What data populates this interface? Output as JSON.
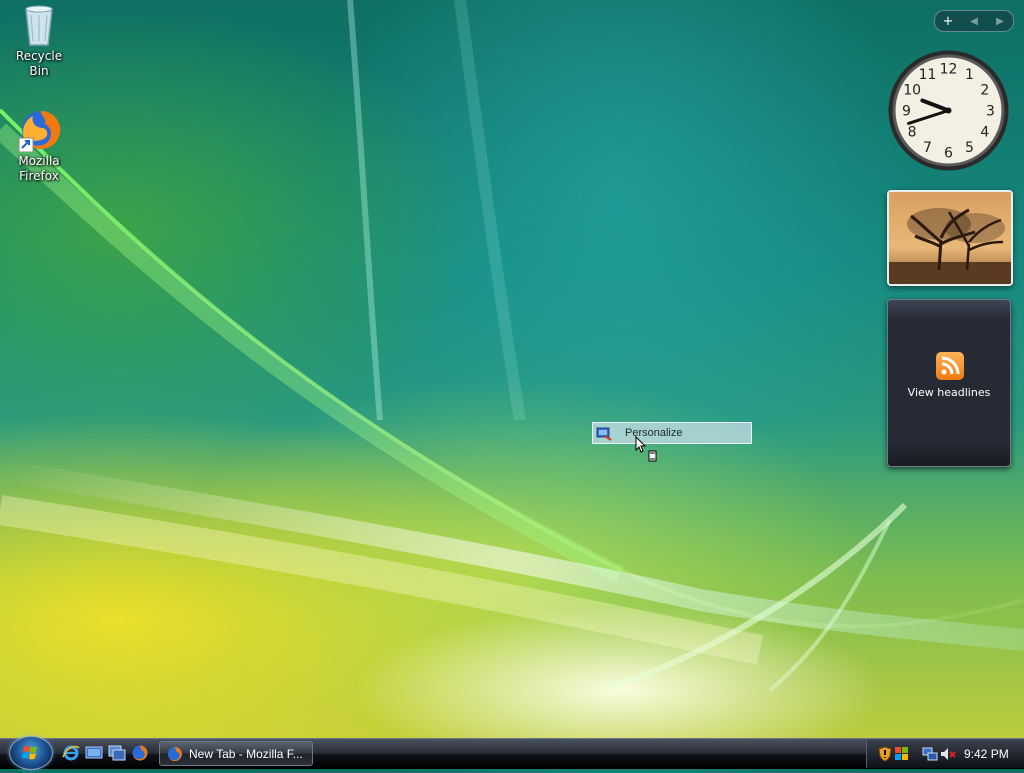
{
  "desktop": {
    "icons": [
      {
        "name": "recycle-bin",
        "label": "Recycle Bin"
      },
      {
        "name": "mozilla-firefox",
        "label": "Mozilla Firefox"
      }
    ]
  },
  "sidebar": {
    "toolbar": {
      "add": "+",
      "prev": "◀",
      "next": "▶"
    },
    "clock": {
      "numbers": [
        "12",
        "1",
        "2",
        "3",
        "4",
        "5",
        "6",
        "7",
        "8",
        "9",
        "10",
        "11"
      ],
      "hour": 9,
      "minute": 42
    },
    "feed": {
      "label": "View headlines"
    }
  },
  "context_menu": {
    "items": [
      {
        "label": "Personalize"
      }
    ]
  },
  "taskbar": {
    "quick_launch": [
      "internet-explorer-icon",
      "show-desktop-icon",
      "switch-windows-icon",
      "firefox-icon"
    ],
    "tasks": [
      {
        "label": "New Tab - Mozilla F..."
      }
    ],
    "tray": {
      "time": "9:42 PM"
    }
  },
  "colors": {
    "accent": "#1a4c8a",
    "taskbar": "#10131a",
    "rss": "#f07a10"
  }
}
